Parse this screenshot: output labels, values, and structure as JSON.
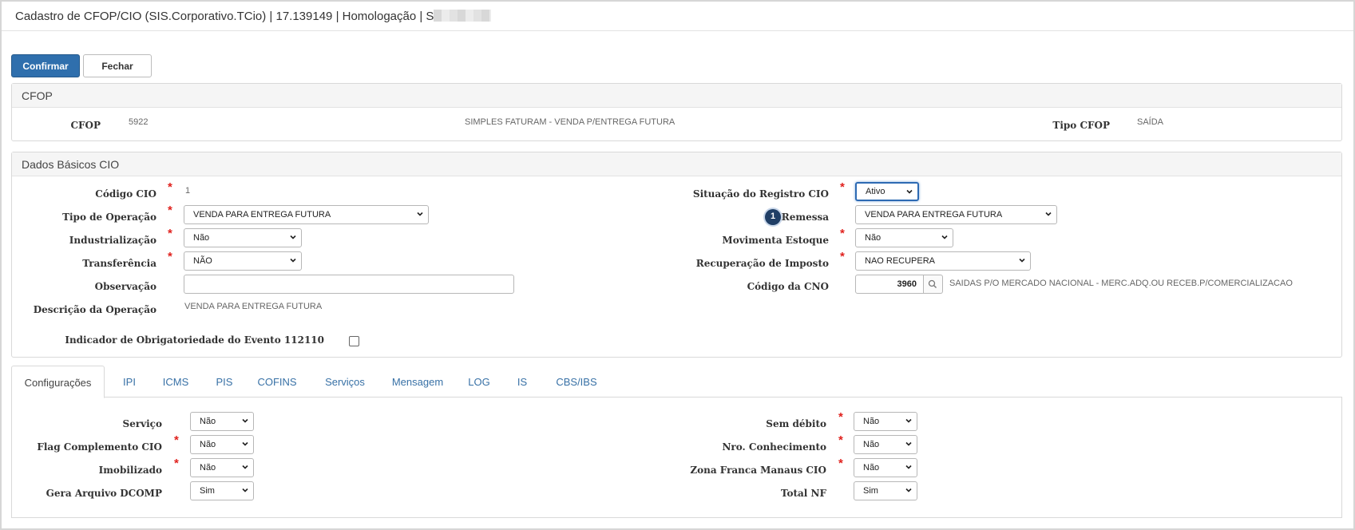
{
  "window": {
    "title": "Cadastro de CFOP/CIO (SIS.Corporativo.TCio) | 17.139149 | Homologação | S"
  },
  "toolbar": {
    "confirm_label": "Confirmar",
    "close_label": "Fechar"
  },
  "cfop_panel": {
    "heading": "CFOP",
    "cfop_label": "CFOP",
    "cfop_value": "5922",
    "cfop_description": "SIMPLES FATURAM - VENDA P/ENTREGA FUTURA",
    "tipo_label": "Tipo CFOP",
    "tipo_value": "SAÍDA"
  },
  "cio_panel": {
    "heading": "Dados Básicos CIO",
    "codigo_label": "Código CIO",
    "codigo_value": "1",
    "tipo_operacao_label": "Tipo de Operação",
    "tipo_operacao_value": "VENDA PARA ENTREGA FUTURA",
    "industrializacao_label": "Industrialização",
    "industrializacao_value": "Não",
    "transferencia_label": "Transferência",
    "transferencia_value": "NÃO",
    "observacao_label": "Observação",
    "observacao_value": "",
    "descricao_label": "Descrição da Operação",
    "descricao_value": "VENDA PARA ENTREGA FUTURA",
    "situacao_label": "Situação do Registro CIO",
    "situacao_value": "Ativo",
    "remessa_badge": "1",
    "remessa_label": "Remessa",
    "remessa_value": "VENDA PARA ENTREGA FUTURA",
    "movimenta_label": "Movimenta Estoque",
    "movimenta_value": "Não",
    "recuperacao_label": "Recuperação de Imposto",
    "recuperacao_value": "NAO RECUPERA",
    "cno_label": "Código da CNO",
    "cno_value": "3960",
    "cno_description": "SAIDAS P/O MERCADO NACIONAL - MERC.ADQ.OU RECEB.P/COMERCIALIZACAO",
    "indicador_label": "Indicador de Obrigatoriedade do Evento 112110",
    "required_mark": "*"
  },
  "tabs": [
    {
      "label": "Configurações",
      "active": true
    },
    {
      "label": "IPI"
    },
    {
      "label": "ICMS"
    },
    {
      "label": "PIS"
    },
    {
      "label": "COFINS"
    },
    {
      "label": "Serviços"
    },
    {
      "label": "Mensagem"
    },
    {
      "label": "LOG"
    },
    {
      "label": "IS"
    },
    {
      "label": "CBS/IBS"
    }
  ],
  "config": {
    "servico_label": "Serviço",
    "servico_value": "Não",
    "flag_label": "Flag Complemento CIO",
    "flag_value": "Não",
    "imobilizado_label": "Imobilizado",
    "imobilizado_value": "Não",
    "gera_label": "Gera Arquivo DCOMP",
    "gera_value": "Sim",
    "sem_debito_label": "Sem débito",
    "sem_debito_value": "Não",
    "nro_label": "Nro. Conhecimento",
    "nro_value": "Não",
    "zona_label": "Zona Franca Manaus CIO",
    "zona_value": "Não",
    "total_label": "Total NF",
    "total_value": "Sim"
  },
  "colors": {
    "primary": "#2f6fad",
    "required": "#e0211d",
    "tab_link": "#3871a6",
    "badge": "#203f66"
  },
  "icons": {
    "select_caret": "chevron-down-icon",
    "lookup": "search-icon"
  }
}
